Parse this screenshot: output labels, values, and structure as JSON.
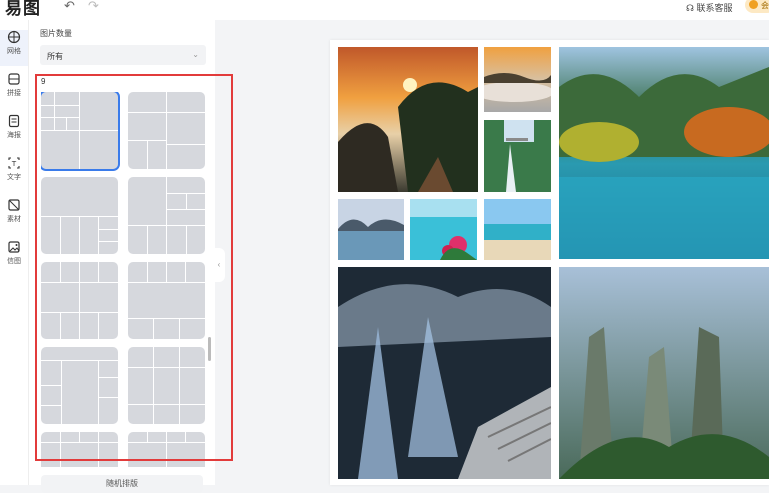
{
  "app": {
    "logo_text": "易图"
  },
  "toolbar": {
    "undo_glyph": "↶",
    "redo_glyph": "↷",
    "contact_label": "联系客服",
    "user_badge": "会"
  },
  "rail": {
    "items": [
      {
        "label": "网格",
        "icon": "grid-icon"
      },
      {
        "label": "拼接",
        "icon": "splice-icon"
      },
      {
        "label": "海报",
        "icon": "poster-icon"
      },
      {
        "label": "文字",
        "icon": "text-icon"
      },
      {
        "label": "素材",
        "icon": "material-icon"
      },
      {
        "label": "信图",
        "icon": "image-icon"
      }
    ]
  },
  "panel": {
    "count_label": "图片数量",
    "select_value": "所有",
    "group_count": "9",
    "bottom_button": "随机排版"
  },
  "canvas": {
    "photos": [
      {
        "name": "photo-sunset-mountain"
      },
      {
        "name": "photo-sea-of-clouds"
      },
      {
        "name": "photo-lake-autumn"
      },
      {
        "name": "photo-waterfall-bridge"
      },
      {
        "name": "photo-lake-reflection"
      },
      {
        "name": "photo-tropical-flowers"
      },
      {
        "name": "photo-beach-lagoon"
      },
      {
        "name": "photo-blue-cascade"
      },
      {
        "name": "photo-karst-peaks"
      }
    ]
  }
}
